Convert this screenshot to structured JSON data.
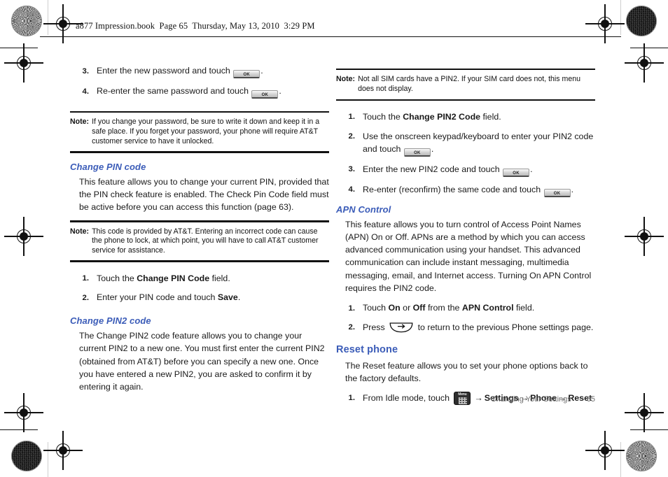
{
  "document": {
    "book_header": "a877 Impression.book  Page 65  Thursday, May 13, 2010  3:29 PM",
    "footer_section": "Changing Your Settings",
    "page_number": "65",
    "heading_color": "#3b5cb8",
    "icons": {
      "ok_button": "ok-button-icon",
      "back_key": "back-key-icon",
      "menu_key": "menu-key-icon",
      "registration": "registration-mark-icon",
      "color_target": "color-target-icon"
    },
    "ok_label": "OK",
    "menu_label": "Menu",
    "arrow": "→"
  },
  "left_column": {
    "steps_top": [
      {
        "num": "3.",
        "before": "Enter the new password and touch ",
        "has_ok": true,
        "after": "."
      },
      {
        "num": "4.",
        "before": "Re-enter the same password and touch ",
        "has_ok": true,
        "after": "."
      }
    ],
    "note_password": {
      "label": "Note:",
      "text": "If you change your password, be sure to write it down and keep it in a safe place. If you forget your password, your phone will require AT&T customer service to have it unlocked."
    },
    "change_pin": {
      "heading": "Change PIN code",
      "body": "This feature allows you to change your current PIN, provided that the PIN check feature is enabled. The Check Pin Code field must be active before you can access this function (page 63)."
    },
    "note_pin": {
      "label": "Note:",
      "text": "This code is provided by AT&T. Entering an incorrect code can cause the phone to lock, at which point, you will have to call AT&T customer service for assistance."
    },
    "pin_steps": [
      {
        "num": "1.",
        "pre": "Touch the ",
        "bold": "Change PIN Code",
        "post": " field."
      },
      {
        "num": "2.",
        "pre": "Enter your PIN code and touch ",
        "bold": "Save",
        "post": "."
      }
    ],
    "change_pin2": {
      "heading": "Change PIN2 code",
      "body": "The Change PIN2 code feature allows you to change your current PIN2 to a new one. You must first enter the current PIN2 (obtained from AT&T) before you can specify a new one. Once you have entered a new PIN2, you are asked to confirm it by entering it again."
    }
  },
  "right_column": {
    "note_pin2": {
      "label": "Note:",
      "text": "Not all SIM cards have a PIN2. If your SIM card does not, this menu does not display."
    },
    "pin2_steps": [
      {
        "num": "1.",
        "pre": "Touch the ",
        "bold": "Change PIN2 Code",
        "post": " field.",
        "has_ok": false
      },
      {
        "num": "2.",
        "pre": "Use the onscreen keypad/keyboard to enter your PIN2 code and touch ",
        "bold": "",
        "post": ".",
        "has_ok": true
      },
      {
        "num": "3.",
        "pre": "Enter the new PIN2 code and touch ",
        "bold": "",
        "post": ".",
        "has_ok": true
      },
      {
        "num": "4.",
        "pre": "Re-enter (reconfirm) the same code and touch ",
        "bold": "",
        "post": ".",
        "has_ok": true
      }
    ],
    "apn_control": {
      "heading": "APN Control",
      "body": "This feature allows you to turn control of Access Point Names (APN) On or Off. APNs are a method by which you can access advanced communication using your handset. This advanced communication can include instant messaging, multimedia messaging, email, and Internet access. Turning On APN Control requires the PIN2 code.",
      "step1": {
        "num": "1.",
        "p1": "Touch ",
        "b1": "On",
        "p2": " or ",
        "b2": "Off",
        "p3": " from the ",
        "b3": "APN Control",
        "p4": " field."
      },
      "step2": {
        "num": "2.",
        "p1": "Press ",
        "p2": " to return to the previous Phone settings page."
      }
    },
    "reset_phone": {
      "heading": "Reset phone",
      "body": "The Reset feature allows you to set your phone options back to the factory defaults.",
      "step1": {
        "num": "1.",
        "pre": "From Idle mode, touch ",
        "item1": "Settings",
        "item2": "Phone",
        "item3": "Reset"
      }
    }
  }
}
